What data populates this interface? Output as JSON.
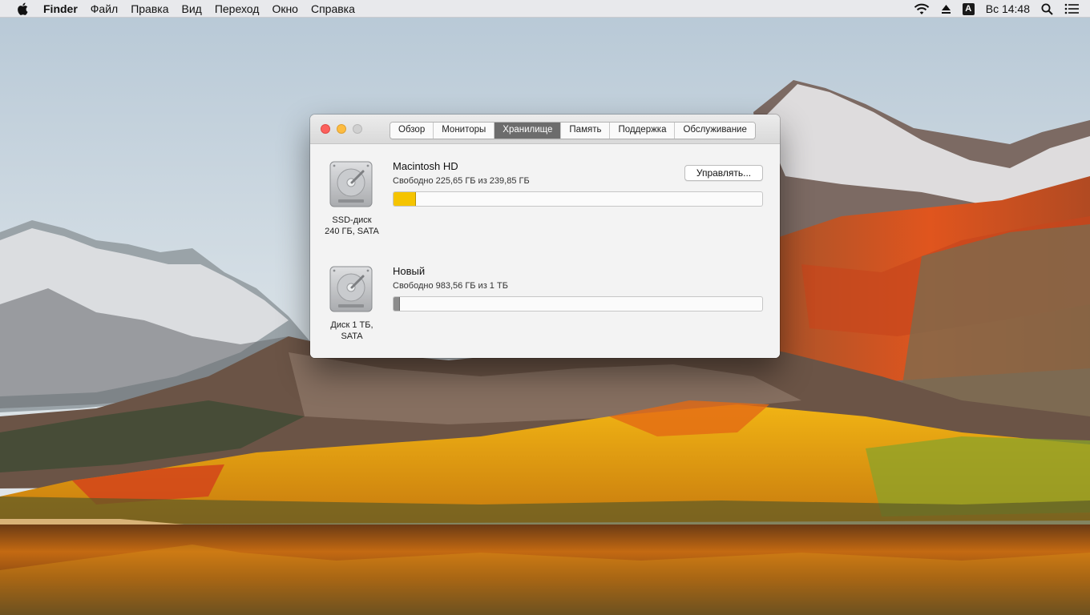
{
  "menubar": {
    "app_name": "Finder",
    "items": [
      "Файл",
      "Правка",
      "Вид",
      "Переход",
      "Окно",
      "Справка"
    ],
    "status": {
      "input_source": "A",
      "clock": "Вс 14:48"
    }
  },
  "window": {
    "tabs": [
      {
        "label": "Обзор",
        "active": false
      },
      {
        "label": "Мониторы",
        "active": false
      },
      {
        "label": "Хранилище",
        "active": true
      },
      {
        "label": "Память",
        "active": false
      },
      {
        "label": "Поддержка",
        "active": false
      },
      {
        "label": "Обслуживание",
        "active": false
      }
    ],
    "disks": [
      {
        "name": "Macintosh HD",
        "free": "Свободно 225,65 ГБ из 239,85 ГБ",
        "caption_line1": "SSD-диск",
        "caption_line2": "240 ГБ, SATA",
        "used_fraction": 0.059,
        "bar_color": "#f5c400",
        "manage_label": "Управлять..."
      },
      {
        "name": "Новый",
        "free": "Свободно 983,56 ГБ из 1 ТБ",
        "caption_line1": "Диск 1 ТБ,",
        "caption_line2": "SATA",
        "used_fraction": 0.016,
        "bar_color": "#8c8c8c"
      }
    ]
  }
}
